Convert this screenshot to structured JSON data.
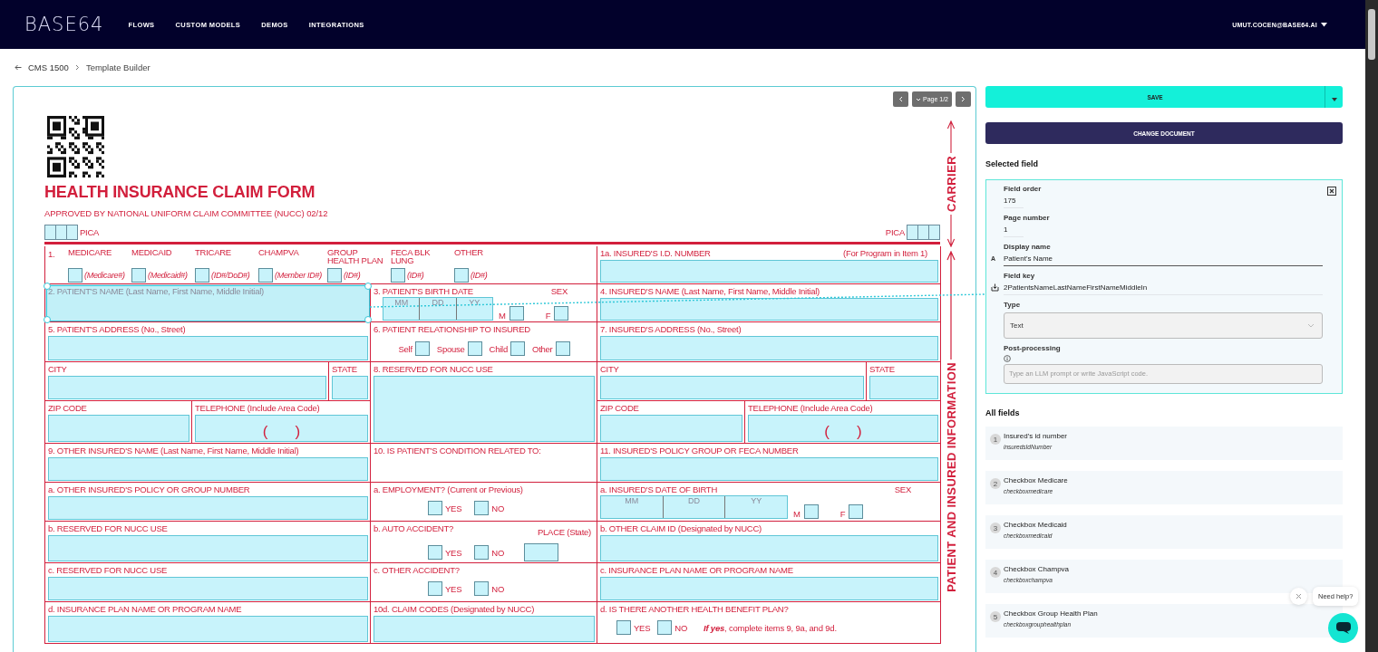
{
  "header": {
    "logo": "BASE64",
    "nav": [
      {
        "label": "FLOWS"
      },
      {
        "label": "CUSTOM MODELS"
      },
      {
        "label": "DEMOS"
      },
      {
        "label": "INTEGRATIONS"
      }
    ],
    "user": "UMUT.COCEN@BASE64.AI"
  },
  "breadcrumb": [
    "CMS 1500",
    "Template Builder"
  ],
  "pager": {
    "label": "Page 1/2"
  },
  "form": {
    "title": "HEALTH INSURANCE CLAIM FORM",
    "subtitle": "APPROVED BY NATIONAL UNIFORM CLAIM COMMITTEE (NUCC) 02/12",
    "pica_left": "PICA",
    "pica_right": "PICA",
    "carrier": "CARRIER",
    "side_label": "PATIENT AND INSURED INFORMATION",
    "rows": [
      {
        "cells": [
          {
            "selected": false,
            "parts": [
              {
                "kind": "program",
                "number": "1.",
                "options": [
                  {
                    "name": "MEDICARE",
                    "hint": "(Medicare#)"
                  },
                  {
                    "name": "MEDICAID",
                    "hint": "(Medicaid#)"
                  },
                  {
                    "name": "TRICARE",
                    "hint": "(ID#/DoD#)"
                  },
                  {
                    "name": "CHAMPVA",
                    "hint": "(Member ID#)"
                  },
                  {
                    "name": "GROUP HEALTH PLAN",
                    "hint": "(ID#)"
                  },
                  {
                    "name": "FECA BLK LUNG",
                    "hint": "(ID#)"
                  },
                  {
                    "name": "OTHER",
                    "hint": "(ID#)"
                  }
                ]
              }
            ]
          },
          {
            "selected": false,
            "parts": [
              {
                "kind": "text",
                "label": "1a. INSURED'S I.D. NUMBER",
                "note": "(For Program in Item 1)"
              }
            ]
          }
        ]
      },
      {
        "cells": [
          {
            "selected": true,
            "parts": [
              {
                "kind": "text",
                "label": "2. PATIENT'S NAME (Last Name, First Name, Middle Initial)"
              }
            ]
          },
          {
            "selected": false,
            "parts": [
              {
                "kind": "date",
                "label": "3. PATIENT'S BIRTH DATE",
                "sub": [
                  "MM",
                  "DD",
                  "YY"
                ],
                "sex": "SEX",
                "options": [
                  "M",
                  "F"
                ]
              }
            ]
          },
          {
            "selected": false,
            "parts": [
              {
                "kind": "text",
                "label": "4. INSURED'S NAME (Last Name, First Name, Middle Initial)"
              }
            ]
          }
        ]
      },
      {
        "cells": [
          {
            "selected": false,
            "parts": [
              {
                "kind": "text",
                "label": "5. PATIENT'S ADDRESS (No., Street)"
              }
            ]
          },
          {
            "selected": false,
            "parts": [
              {
                "kind": "relation",
                "label": "6. PATIENT RELATIONSHIP TO INSURED",
                "options": [
                  "Self",
                  "Spouse",
                  "Child",
                  "Other"
                ]
              }
            ]
          },
          {
            "selected": false,
            "parts": [
              {
                "kind": "text",
                "label": "7. INSURED'S ADDRESS (No., Street)"
              }
            ]
          }
        ]
      },
      {
        "cells": [
          {
            "selected": false,
            "parts": [
              {
                "kind": "text",
                "label": "CITY"
              },
              {
                "kind": "text",
                "label": "STATE"
              }
            ]
          },
          {
            "selected": false,
            "parts": [
              {
                "kind": "tall",
                "label": "8. RESERVED FOR NUCC USE"
              }
            ]
          },
          {
            "selected": false,
            "parts": [
              {
                "kind": "text",
                "label": "CITY"
              },
              {
                "kind": "text",
                "label": "STATE"
              }
            ]
          }
        ]
      },
      {
        "cells": [
          {
            "selected": false,
            "parts": [
              {
                "kind": "text",
                "label": "ZIP CODE"
              },
              {
                "kind": "text",
                "label": "TELEPHONE (Include Area Code)",
                "marks": [
                  "(",
                  ")"
                ]
              }
            ]
          },
          {
            "selected": false,
            "parts": [
              {
                "kind": "text",
                "label": "ZIP CODE"
              },
              {
                "kind": "text",
                "label": "TELEPHONE (Include Area Code)",
                "marks": [
                  "(",
                  ")"
                ]
              }
            ]
          }
        ]
      },
      {
        "cells": [
          {
            "selected": false,
            "parts": [
              {
                "kind": "text",
                "label": "9. OTHER INSURED'S NAME (Last Name, First Name, Middle Initial)"
              }
            ]
          },
          {
            "selected": false,
            "parts": [
              {
                "kind": "label",
                "label": "10. IS PATIENT'S CONDITION RELATED TO:"
              }
            ]
          },
          {
            "selected": false,
            "parts": [
              {
                "kind": "text",
                "label": "11. INSURED'S POLICY GROUP OR FECA NUMBER"
              }
            ]
          }
        ]
      },
      {
        "cells": [
          {
            "selected": false,
            "parts": [
              {
                "kind": "text",
                "label": "a. OTHER INSURED'S POLICY OR GROUP NUMBER"
              }
            ]
          },
          {
            "selected": false,
            "parts": [
              {
                "kind": "checks",
                "label": "a. EMPLOYMENT? (Current or Previous)",
                "options": [
                  "YES",
                  "NO"
                ]
              }
            ]
          },
          {
            "selected": false,
            "parts": [
              {
                "kind": "date",
                "label": "a. INSURED'S DATE OF BIRTH",
                "sub": [
                  "MM",
                  "DD",
                  "YY"
                ],
                "sex": "SEX",
                "options": [
                  "M",
                  "F"
                ]
              }
            ]
          }
        ]
      },
      {
        "cells": [
          {
            "selected": false,
            "parts": [
              {
                "kind": "text",
                "label": "b. RESERVED FOR NUCC USE"
              }
            ]
          },
          {
            "selected": false,
            "parts": [
              {
                "kind": "checks",
                "label": "b. AUTO ACCIDENT?",
                "place": "PLACE (State)",
                "options": [
                  "YES",
                  "NO"
                ]
              }
            ]
          },
          {
            "selected": false,
            "parts": [
              {
                "kind": "text",
                "label": "b. OTHER CLAIM ID (Designated by NUCC)"
              }
            ]
          }
        ]
      },
      {
        "cells": [
          {
            "selected": false,
            "parts": [
              {
                "kind": "text",
                "label": "c. RESERVED FOR NUCC USE"
              }
            ]
          },
          {
            "selected": false,
            "parts": [
              {
                "kind": "checks",
                "label": "c. OTHER ACCIDENT?",
                "options": [
                  "YES",
                  "NO"
                ]
              }
            ]
          },
          {
            "selected": false,
            "parts": [
              {
                "kind": "text",
                "label": "c. INSURANCE PLAN NAME OR PROGRAM NAME"
              }
            ]
          }
        ]
      },
      {
        "cells": [
          {
            "selected": false,
            "parts": [
              {
                "kind": "text",
                "label": "d. INSURANCE PLAN NAME OR PROGRAM NAME"
              }
            ]
          },
          {
            "selected": false,
            "parts": [
              {
                "kind": "text",
                "label": "10d. CLAIM CODES (Designated by NUCC)"
              }
            ]
          },
          {
            "selected": false,
            "parts": [
              {
                "kind": "checks",
                "label": "d. IS THERE ANOTHER HEALTH BENEFIT PLAN?",
                "options": [
                  "YES",
                  "NO"
                ],
                "remark": "**If yes**, complete items 9, 9a, and 9d."
              }
            ]
          }
        ]
      }
    ]
  },
  "panel": {
    "save": "SAVE",
    "change": "CHANGE DOCUMENT",
    "selected_title": "Selected field",
    "field": {
      "order_label": "Field order",
      "order": "175",
      "page_label": "Page number",
      "page": "1",
      "display_label": "Display name",
      "display_icon": "A",
      "display": "Patient's Name",
      "key_label": "Field key",
      "key": "2PatientsNameLastNameFirstNameMiddleIn",
      "type_label": "Type",
      "type": "Text",
      "post_label": "Post-processing",
      "post_placeholder": "Type an LLM prompt or write JavaScript code."
    },
    "all_title": "All fields",
    "fields": [
      {
        "number": "1",
        "name": "Insured's id number",
        "key": "insuredsIdNumber"
      },
      {
        "number": "2",
        "name": "Checkbox Medicare",
        "key": "checkboxmedicare"
      },
      {
        "number": "3",
        "name": "Checkbox Medicaid",
        "key": "checkboxmedicaid"
      },
      {
        "number": "4",
        "name": "Checkbox Champva",
        "key": "checkboxchampva"
      },
      {
        "number": "5",
        "name": "Checkbox Group Health Plan",
        "key": "checkboxgrouphealthplan"
      }
    ]
  },
  "help": "Need help?"
}
